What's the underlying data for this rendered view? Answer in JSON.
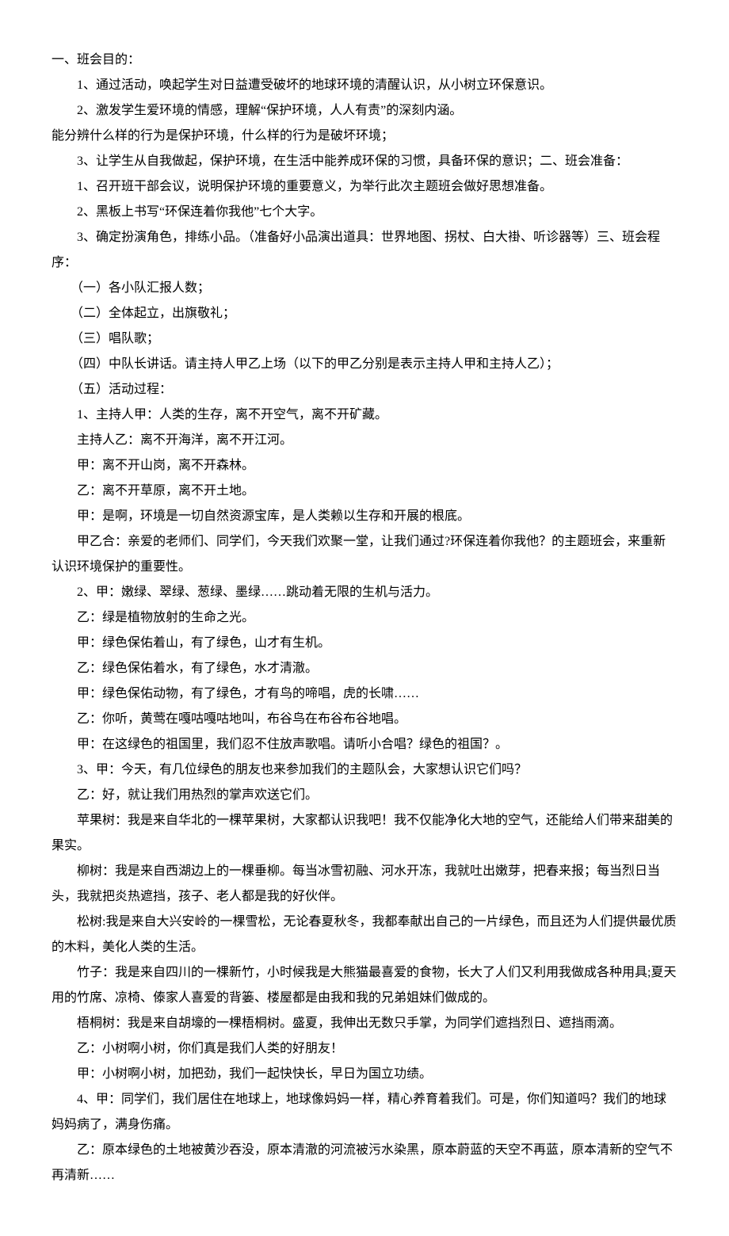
{
  "lines": [
    "一、班会目的：",
    "　　1、通过活动，唤起学生对日益遭受破坏的地球环境的清醒认识，从小树立环保意识。",
    "　　2、激发学生爱环境的情感，理解“保护环境，人人有责”的深刻内涵。",
    "能分辨什么样的行为是保护环境，什么样的行为是破坏环境；",
    "　　3、让学生从自我做起，保护环境，在生活中能养成环保的习惯，具备环保的意识；二、班会准备：",
    "　　1、召开班干部会议，说明保护环境的重要意义，为举行此次主题班会做好思想准备。",
    "　　2、黑板上书写“环保连着你我他”七个大字。",
    "　　3、确定扮演角色，排练小品。（准备好小品演出道具：世界地图、拐杖、白大褂、听诊器等）三、班会程序：",
    "　　（一）各小队汇报人数；",
    "　　（二）全体起立，出旗敬礼；",
    "　　（三）唱队歌；",
    "　　（四）中队长讲话。请主持人甲乙上场（以下的甲乙分别是表示主持人甲和主持人乙）；",
    "　　（五）活动过程：",
    "　　1、主持人甲：人类的生存，离不开空气，离不开矿藏。",
    "　　主持人乙：离不开海洋，离不开江河。",
    "　　甲：离不开山岗，离不开森林。",
    "　　乙：离不开草原，离不开土地。",
    "　　甲：是啊，环境是一切自然资源宝库，是人类赖以生存和开展的根底。",
    "　　甲乙合：亲爱的老师们、同学们，今天我们欢聚一堂，让我们通过?环保连着你我他？的主题班会，来重新认识环境保护的重要性。",
    "　　2、甲：嫩绿、翠绿、葱绿、墨绿……跳动着无限的生机与活力。",
    "　　乙：绿是植物放射的生命之光。",
    "　　甲：绿色保佑着山，有了绿色，山才有生机。",
    "　　乙：绿色保佑着水，有了绿色，水才清澈。",
    "　　甲：绿色保佑动物，有了绿色，才有鸟的啼唱，虎的长啸……",
    "　　乙：你听，黄莺在嘎咕嘎咕地叫，布谷鸟在布谷布谷地唱。",
    "　　甲：在这绿色的祖国里，我们忍不住放声歌唱。请听小合唱？绿色的祖国？。",
    "　　3、甲：今天，有几位绿色的朋友也来参加我们的主题队会，大家想认识它们吗？",
    "　　乙：好，就让我们用热烈的掌声欢送它们。",
    "　　苹果树：我是来自华北的一棵苹果树，大家都认识我吧！我不仅能净化大地的空气，还能给人们带来甜美的果实。",
    "　　柳树：我是来自西湖边上的一棵垂柳。每当冰雪初融、河水开冻，我就吐出嫩芽，把春来报；每当烈日当头，我就把炎热遮挡，孩子、老人都是我的好伙伴。",
    "　　松树:我是来自大兴安岭的一棵雪松，无论春夏秋冬，我都奉献出自己的一片绿色，而且还为人们提供最优质的木料，美化人类的生活。",
    "　　竹子：我是来自四川的一棵新竹，小时候我是大熊猫最喜爱的食物，长大了人们又利用我做成各种用具;夏天用的竹席、凉椅、傣家人喜爱的背篓、楼屋都是由我和我的兄弟姐妹们做成的。",
    "　　梧桐树：我是来自胡壕的一棵梧桐树。盛夏，我伸出无数只手掌，为同学们遮挡烈日、遮挡雨滴。",
    "　　乙：小树啊小树，你们真是我们人类的好朋友！",
    "　　甲：小树啊小树，加把劲，我们一起快快长，早日为国立功绩。",
    "　　4、甲：同学们，我们居住在地球上，地球像妈妈一样，精心养育着我们。可是，你们知道吗？我们的地球妈妈病了，满身伤痛。",
    "　　乙：原本绿色的土地被黄沙吞没，原本清澈的河流被污水染黑，原本蔚蓝的天空不再蓝，原本清新的空气不再清新……"
  ]
}
